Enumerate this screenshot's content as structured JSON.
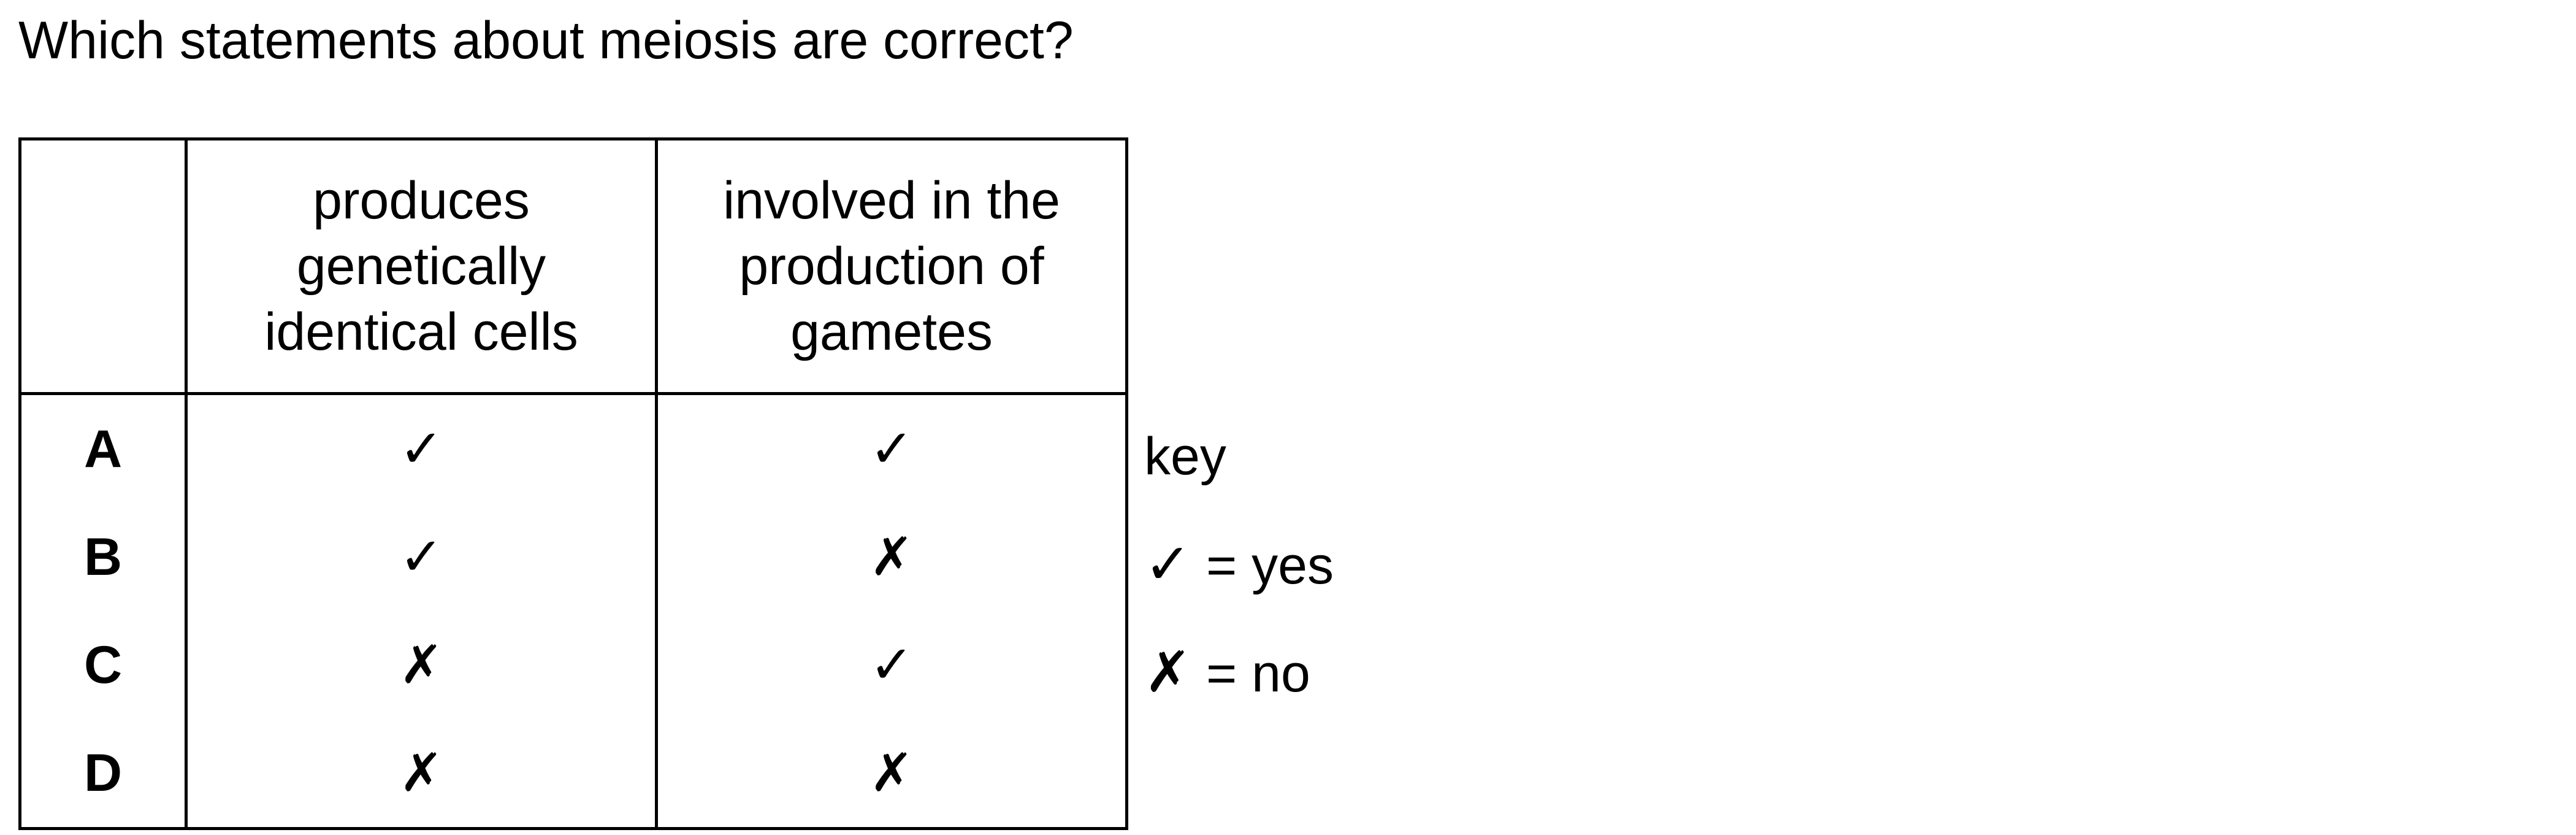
{
  "question": "Which statements about meiosis are correct?",
  "table": {
    "headers": [
      "",
      "produces genetically identical cells",
      "involved in the production of gametes"
    ],
    "header_lines": {
      "col1": [
        "produces",
        "genetically",
        "identical cells"
      ],
      "col2": [
        "involved in the",
        "production of",
        "gametes"
      ]
    },
    "rows": [
      {
        "label": "A",
        "col1": "✓",
        "col2": "✓"
      },
      {
        "label": "B",
        "col1": "✓",
        "col2": "✗"
      },
      {
        "label": "C",
        "col1": "✗",
        "col2": "✓"
      },
      {
        "label": "D",
        "col1": "✗",
        "col2": "✗"
      }
    ]
  },
  "key": {
    "title": "key",
    "yes_symbol": "✓",
    "yes_text": "= yes",
    "no_symbol": "✗",
    "no_text": "= no"
  }
}
